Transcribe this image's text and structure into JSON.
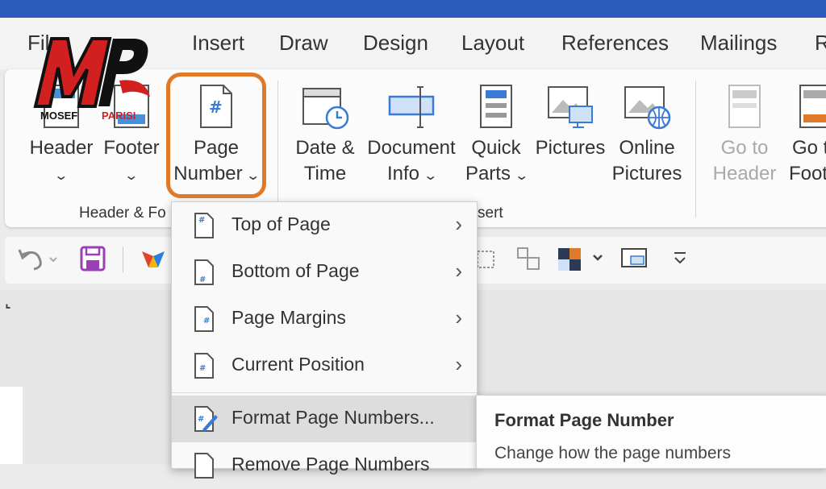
{
  "tabs": [
    "File",
    "Insert",
    "Draw",
    "Design",
    "Layout",
    "References",
    "Mailings",
    "R"
  ],
  "ribbon": {
    "header": {
      "label": "Header"
    },
    "footer": {
      "label": "Footer"
    },
    "page_number": {
      "line1": "Page",
      "line2": "Number"
    },
    "date_time": {
      "line1": "Date &",
      "line2": "Time"
    },
    "document_info": {
      "line1": "Document",
      "line2": "Info"
    },
    "quick_parts": {
      "line1": "Quick",
      "line2": "Parts"
    },
    "pictures": {
      "label": "Pictures"
    },
    "online_pictures": {
      "line1": "Online",
      "line2": "Pictures"
    },
    "go_to_header": {
      "line1": "Go to",
      "line2": "Header"
    },
    "go_to_footer": {
      "line1": "Go t",
      "line2": "Foot"
    },
    "chevron": "⌄",
    "groups": {
      "header_footer": "Header & Fo",
      "insert": "sert"
    }
  },
  "dropdown": {
    "items": [
      {
        "label": "Top of Page",
        "arrow": "›"
      },
      {
        "label": "Bottom of Page",
        "arrow": "›"
      },
      {
        "label": "Page Margins",
        "arrow": "›"
      },
      {
        "label": "Current Position",
        "arrow": "›"
      },
      {
        "label": "Format Page Numbers..."
      },
      {
        "label": "Remove Page Numbers"
      }
    ]
  },
  "tooltip": {
    "title": "Format Page Number",
    "description": "Change how the page numbers"
  },
  "watermark": {
    "line1": "MOSEF",
    "line2": "PARISI"
  },
  "colors": {
    "accent": "#2b5cbd",
    "highlight": "#e07a2b",
    "logo_red": "#d21f1f"
  }
}
